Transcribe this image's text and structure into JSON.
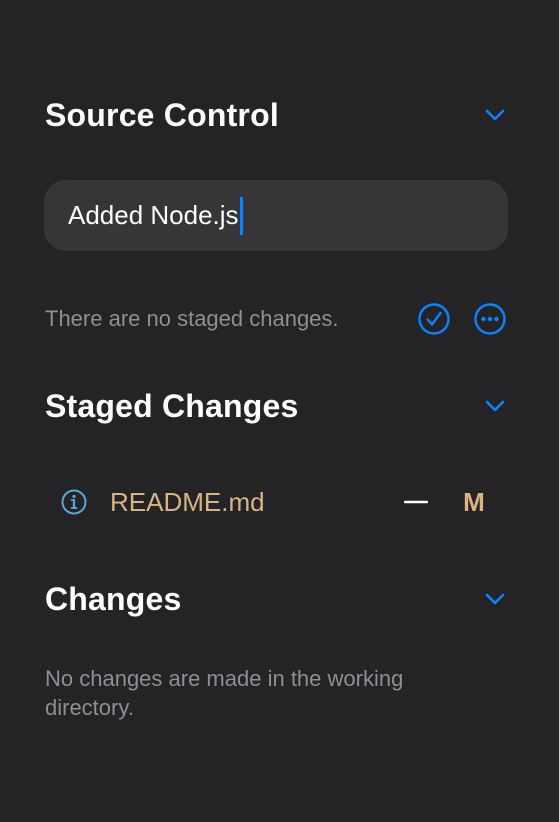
{
  "source_control": {
    "title": "Source Control",
    "collapse_icon": "chevron-down-icon",
    "commit_message": "Added Node.js",
    "staged_info": "There are no staged changes.",
    "commit_icon": "checkmark-circle-icon",
    "more_icon": "ellipsis-circle-icon"
  },
  "staged_changes": {
    "title": "Staged Changes",
    "files": [
      {
        "name": "README.md",
        "status": "M",
        "info_icon": "info-circle-icon",
        "unstage_icon": "minus-icon"
      }
    ]
  },
  "changes": {
    "title": "Changes",
    "empty_message": "No changes are made in the working directory."
  },
  "colors": {
    "background": "#242426",
    "accent": "#0a84ff",
    "modified": "#d9b382",
    "muted_text": "#8e8e93",
    "input_background": "#363638"
  }
}
